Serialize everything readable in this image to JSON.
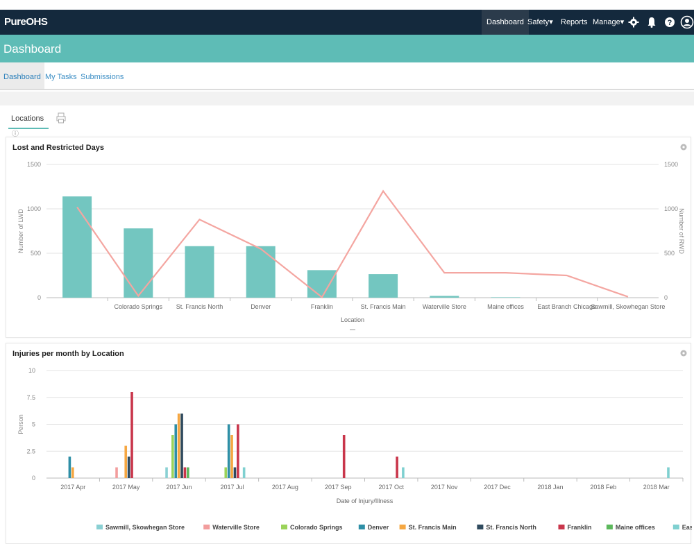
{
  "app": {
    "brand": "PureOHS"
  },
  "nav": {
    "items": [
      "Dashboard",
      "Safety",
      "Reports",
      "Manage"
    ],
    "icons": [
      "gear-icon",
      "bell-icon",
      "help-icon",
      "user-icon"
    ]
  },
  "page": {
    "title": "Dashboard"
  },
  "subtabs": [
    "Dashboard",
    "My Tasks",
    "Submissions"
  ],
  "locations_tab": {
    "label": "Locations"
  },
  "colors": {
    "nav_bg": "#14293d",
    "accent": "#5ebcb6",
    "bar": "#73c6c0",
    "line": "#f4a6a1"
  },
  "chart1": {
    "title": "Lost and Restricted Days",
    "ylabel": "Number of LWD",
    "y2label": "Number of RWD",
    "xlabel": "Location",
    "yticks": [
      "1500",
      "1000",
      "500",
      "0"
    ]
  },
  "chart2": {
    "title": "Injuries per month by Location",
    "ylabel": "Person",
    "xlabel": "Date of Injury/Illness",
    "yticks": [
      "10",
      "7.5",
      "5",
      "2.5",
      "0"
    ]
  },
  "chart_data": [
    {
      "type": "bar",
      "title": "Lost and Restricted Days",
      "categories": [
        "",
        "Colorado Springs",
        "St. Francis North",
        "Denver",
        "Franklin",
        "St. Francis Main",
        "Waterville Store",
        "Maine offices",
        "East Branch Chicago",
        "Sawmill, Skowhegan Store"
      ],
      "series": [
        {
          "name": "Number of LWD",
          "values": [
            1140,
            780,
            580,
            580,
            310,
            265,
            20,
            5,
            0,
            0
          ]
        },
        {
          "name": "Number of RWD",
          "values": [
            1020,
            20,
            880,
            550,
            5,
            1200,
            280,
            280,
            250,
            10
          ]
        }
      ],
      "xlabel": "Location",
      "ylabel": "Number of LWD",
      "y2label": "Number of RWD",
      "ylim": [
        0,
        1500
      ],
      "grid": true
    },
    {
      "type": "bar",
      "title": "Injuries per month by Location",
      "categories": [
        "2017 Apr",
        "2017 May",
        "2017 Jun",
        "2017 Jul",
        "2017 Aug",
        "2017 Sep",
        "2017 Oct",
        "2017 Nov",
        "2017 Dec",
        "2018 Jan",
        "2018 Feb",
        "2018 Mar"
      ],
      "legend": [
        "Sawmill, Skowhegan Store",
        "Waterville Store",
        "Colorado Springs",
        "Denver",
        "St. Francis Main",
        "St. Francis North",
        "Franklin",
        "Maine offices",
        "East Branch Chicago"
      ],
      "series": [
        {
          "name": "Sawmill, Skowhegan Store",
          "color": "#8ad0d3",
          "values": [
            0,
            0,
            1,
            0,
            0,
            0,
            0,
            0,
            0,
            0,
            0,
            0
          ]
        },
        {
          "name": "Waterville Store",
          "color": "#f29d9d",
          "values": [
            0,
            1,
            0,
            0,
            0,
            0,
            0,
            0,
            0,
            0,
            0,
            0
          ]
        },
        {
          "name": "Colorado Springs",
          "color": "#9bd35a",
          "values": [
            0,
            0,
            4,
            1,
            0,
            0,
            0,
            0,
            0,
            0,
            0,
            0
          ]
        },
        {
          "name": "Denver",
          "color": "#2e8fa6",
          "values": [
            2,
            0,
            5,
            5,
            0,
            0,
            0,
            0,
            0,
            0,
            0,
            0
          ]
        },
        {
          "name": "St. Francis Main",
          "color": "#f5a742",
          "values": [
            1,
            3,
            6,
            4,
            0,
            0,
            0,
            0,
            0,
            0,
            0,
            0
          ]
        },
        {
          "name": "St. Francis North",
          "color": "#2f4a5e",
          "values": [
            0,
            2,
            6,
            1,
            0,
            0,
            0,
            0,
            0,
            0,
            0,
            0
          ]
        },
        {
          "name": "Franklin",
          "color": "#c9364b",
          "values": [
            0,
            8,
            1,
            5,
            0,
            4,
            2,
            0,
            0,
            0,
            0,
            0
          ]
        },
        {
          "name": "Maine offices",
          "color": "#5cb85c",
          "values": [
            0,
            0,
            1,
            0,
            0,
            0,
            0,
            0,
            0,
            0,
            0,
            0
          ]
        },
        {
          "name": "East Branch Chicago",
          "color": "#7fd0d0",
          "values": [
            0,
            0,
            0,
            1,
            0,
            0,
            1,
            0,
            0,
            0,
            0,
            1
          ]
        }
      ],
      "xlabel": "Date of Injury/Illness",
      "ylabel": "Person",
      "ylim": [
        0,
        10
      ],
      "grid": true
    }
  ]
}
